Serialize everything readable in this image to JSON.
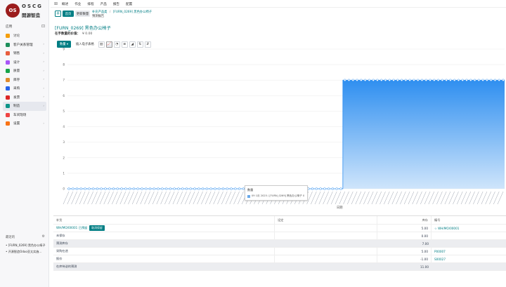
{
  "logo": {
    "mark": "OS",
    "top": "OSCG",
    "bottom": "開源智造"
  },
  "sidebar": {
    "apps_label": "应用",
    "items": [
      {
        "label": "讨论",
        "color": "#f59e0b",
        "chevron": ""
      },
      {
        "label": "客户关系管理",
        "color": "#1d8f5b",
        "chevron": "›"
      },
      {
        "label": "销售",
        "color": "#e85d3d",
        "chevron": "›"
      },
      {
        "label": "设计",
        "color": "#a855f7",
        "chevron": "›"
      },
      {
        "label": "质量",
        "color": "#16a34a",
        "chevron": "›"
      },
      {
        "label": "库存",
        "color": "#e08a2b",
        "chevron": "›"
      },
      {
        "label": "采购",
        "color": "#2563eb",
        "chevron": "›"
      },
      {
        "label": "发票",
        "color": "#dc2626",
        "chevron": "›"
      },
      {
        "label": "制造",
        "color": "#0d9488",
        "chevron": "›",
        "active": true
      },
      {
        "label": "车间现场",
        "color": "#ef4444",
        "chevron": ""
      },
      {
        "label": "设置",
        "color": "#f97316",
        "chevron": "›"
      }
    ],
    "recent_label": "最近的",
    "recent": [
      "[FURN_0269] 黑色办公椅子",
      "开源智造Odoo亚太实施..."
    ]
  },
  "topbar": {
    "menu": [
      "概述",
      "作业",
      "排程",
      "产品",
      "报告",
      "配置"
    ]
  },
  "control": {
    "new_label": "+",
    "btn_home": "首页",
    "btn_update": "更新数量",
    "breadcrumb": [
      "补充产品类",
      "[FURN_0269] 黑色办公椅子"
    ],
    "subtitle": "预测报告"
  },
  "report": {
    "title": "[FURN_0269] 黑色办公椅子",
    "valuation_label": "在手数量的价值：",
    "valuation_value": "¥ 0.00"
  },
  "toolbar": {
    "data_label": "数量",
    "sheet_label": "插入电子表格",
    "icons": [
      "bar-chart-icon",
      "line-chart-icon",
      "pie-chart-icon",
      "stack-icon",
      "cumulative-icon",
      "sort-asc-icon",
      "sort-desc-icon"
    ],
    "icon_glyphs": [
      "▥",
      "📈",
      "◔",
      "≣",
      "◢",
      "⇅",
      "⇵"
    ]
  },
  "chart_data": {
    "type": "area",
    "ylim": [
      0,
      9
    ],
    "yticks": [
      0,
      1,
      2,
      3,
      4,
      5,
      6,
      7,
      8,
      9
    ],
    "xlabel": "日期",
    "series": [
      {
        "values": [
          0,
          7
        ]
      }
    ],
    "step_fraction": 0.63
  },
  "tooltip": {
    "title": "数量",
    "row": "09 1月 2025 / [FURN_0269] 黑色办公椅子  0"
  },
  "table": {
    "headers": [
      "补货",
      "设定",
      "库存",
      "编号"
    ],
    "rows": [
      {
        "c1": "WH/MO/00001 已预留",
        "btn": "取消保留",
        "c2": "",
        "c3": "5.00",
        "c4": "☆ WH/MO/00001",
        "style": "white"
      },
      {
        "c1": "未保存",
        "c2": "",
        "c3": "0.00",
        "c4": "",
        "style": "white"
      },
      {
        "c1": "预测库存",
        "c2": "",
        "c3": "7.00",
        "c4": "",
        "style": "gray"
      },
      {
        "c1": "采购在途",
        "c2": "",
        "c3": "5.00",
        "c4": "P00007",
        "style": "white"
      },
      {
        "c1": "报价",
        "c2": "",
        "c3": "-1.00",
        "c4": "S00027",
        "style": "white"
      },
      {
        "c1": "在库待送的预测",
        "c2": "",
        "c3": "11.00",
        "c4": "",
        "style": "gray"
      }
    ]
  }
}
